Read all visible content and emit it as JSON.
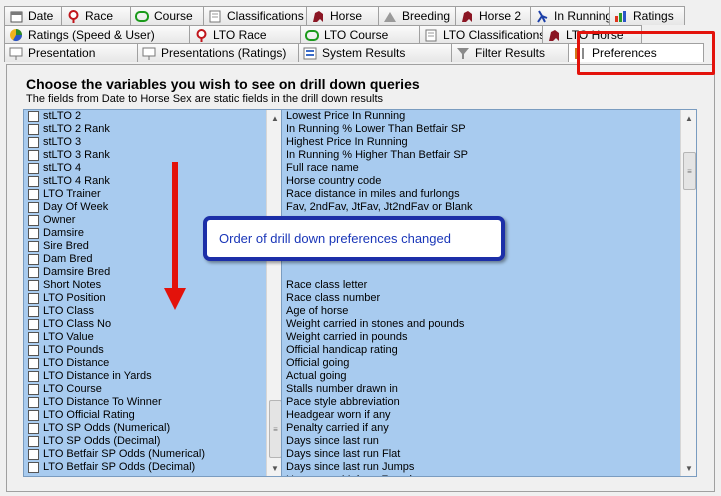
{
  "tabs": {
    "row1": [
      {
        "label": "Date",
        "icon": "calendar-icon"
      },
      {
        "label": "Race",
        "icon": "pin-icon"
      },
      {
        "label": "Course",
        "icon": "course-icon"
      },
      {
        "label": "Classifications",
        "icon": "document-icon"
      },
      {
        "label": "Horse",
        "icon": "horse-icon"
      },
      {
        "label": "Breeding",
        "icon": "breeding-icon"
      },
      {
        "label": "Horse 2",
        "icon": "horse-icon"
      },
      {
        "label": "In Running",
        "icon": "running-icon"
      },
      {
        "label": "Ratings",
        "icon": "bar-chart-icon"
      }
    ],
    "row2": [
      {
        "label": "Ratings (Speed & User)",
        "icon": "pie-chart-icon"
      },
      {
        "label": "LTO Race",
        "icon": "pin-icon"
      },
      {
        "label": "LTO Course",
        "icon": "course-icon"
      },
      {
        "label": "LTO Classifications",
        "icon": "document-icon"
      },
      {
        "label": "LTO Horse",
        "icon": "horse-icon"
      }
    ],
    "row3": [
      {
        "label": "Presentation",
        "icon": "presentation-icon"
      },
      {
        "label": "Presentations (Ratings)",
        "icon": "presentation-icon"
      },
      {
        "label": "System Results",
        "icon": "results-icon"
      },
      {
        "label": "Filter Results",
        "icon": "filter-icon"
      },
      {
        "label": "Preferences",
        "icon": "tools-icon"
      }
    ]
  },
  "heading": "Choose the variables you wish to see on drill down queries",
  "subheading": "The fields from Date to Horse Sex are static fields in the drill down results",
  "left_list": [
    "stLTO 2",
    "stLTO 2 Rank",
    "stLTO 3",
    "stLTO 3 Rank",
    "stLTO 4",
    "stLTO 4 Rank",
    "LTO Trainer",
    "Day Of Week",
    "Owner",
    "Damsire",
    "Sire Bred",
    "Dam Bred",
    "Damsire Bred",
    "Short Notes",
    "LTO Position",
    "LTO Class",
    "LTO Class No",
    "LTO Value",
    "LTO Pounds",
    "LTO Distance",
    "LTO Distance in Yards",
    "LTO Course",
    "LTO Distance To Winner",
    "LTO Official Rating",
    "LTO SP Odds (Numerical)",
    "LTO SP Odds (Decimal)",
    "LTO Betfair SP Odds (Numerical)",
    "LTO Betfair SP Odds (Decimal)"
  ],
  "right_list": [
    "Lowest Price In Running",
    "In Running % Lower Than Betfair SP",
    "Highest Price In Running",
    "In Running % Higher Than Betfair SP",
    "Full race name",
    "Horse country code",
    "Race distance in miles and furlongs",
    "Fav, 2ndFav, JtFav, Jt2ndFav or Blank",
    "",
    "",
    "",
    "",
    "",
    "Race class letter",
    "Race class number",
    "Age of horse",
    "Weight carried in stones and pounds",
    "Weight carried in pounds",
    "Official handicap rating",
    "Official going",
    "Actual going",
    "Stalls number drawn in",
    "Pace style abbreviation",
    "Headgear worn if any",
    "Penalty carried if any",
    "Days since last run",
    "Days since last run Flat",
    "Days since last run Jumps",
    "Horse sex, Male or Female"
  ],
  "callout": "Order of drill down preferences changed",
  "colors": {
    "selection": "#a8cbef",
    "callout_border": "#1c2fa8",
    "highlight_red": "#e3120b"
  }
}
